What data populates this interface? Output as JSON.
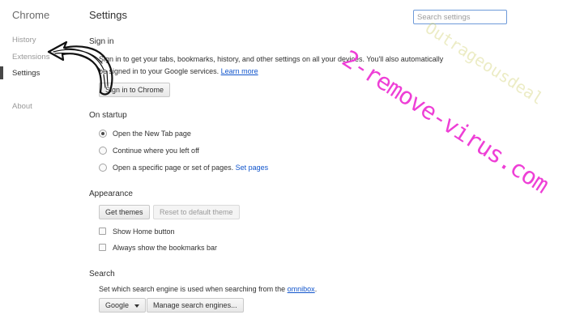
{
  "sidebar": {
    "title": "Chrome",
    "items": [
      {
        "label": "History"
      },
      {
        "label": "Extensions"
      },
      {
        "label": "Settings"
      },
      {
        "label": "About"
      }
    ]
  },
  "header": {
    "title": "Settings",
    "search_placeholder": "Search settings"
  },
  "sign_in": {
    "title": "Sign in",
    "description_line1": "Sign in to get your tabs, bookmarks, history, and other settings on all your devices. You'll also automatically",
    "description_line2": "be signed in to your Google services.",
    "learn_more": "Learn more",
    "button_label": "Sign in to Chrome"
  },
  "on_startup": {
    "title": "On startup",
    "options": [
      {
        "label": "Open the New Tab page",
        "selected": true
      },
      {
        "label": "Continue where you left off",
        "selected": false
      },
      {
        "label": "Open a specific page or set of pages.",
        "selected": false
      }
    ],
    "set_pages_link": "Set pages"
  },
  "appearance": {
    "title": "Appearance",
    "get_themes": "Get themes",
    "reset_theme": "Reset to default theme",
    "checkboxes": [
      {
        "label": "Show Home button",
        "checked": false
      },
      {
        "label": "Always show the bookmarks bar",
        "checked": false
      }
    ]
  },
  "search": {
    "title": "Search",
    "description": "Set which search engine is used when searching from the",
    "omnibox_link": "omnibox",
    "period": ".",
    "engine_selected": "Google",
    "manage_button": "Manage search engines..."
  },
  "watermark": {
    "main_text": "2-remove-virus.com",
    "faint_text": "Outrageousdeal"
  },
  "colors": {
    "accent_link": "#1155cc",
    "watermark": "#ee3fd6",
    "search_border": "#6e9ad9"
  }
}
